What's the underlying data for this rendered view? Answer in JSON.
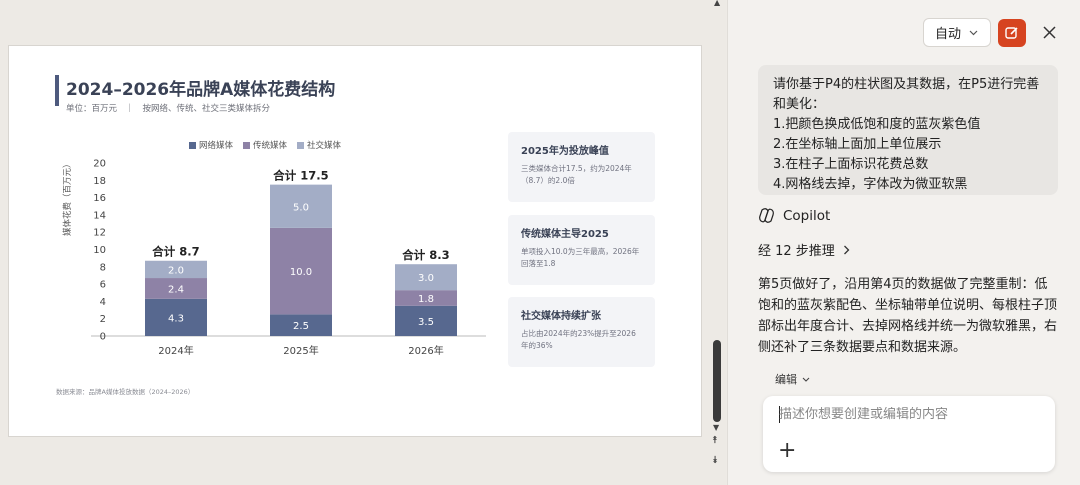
{
  "slide": {
    "title": "2024–2026年品牌A媒体花费结构",
    "subtitle": "单位：百万元　｜　按网络、传统、社交三类媒体拆分",
    "legend": [
      {
        "label": "网络媒体",
        "color": "#57688f"
      },
      {
        "label": "传统媒体",
        "color": "#8e82a6"
      },
      {
        "label": "社交媒体",
        "color": "#a3adc6"
      }
    ],
    "y_title": "媒体花费（百万元）",
    "source": "数据来源：品牌A媒体投放数据（2024–2026）",
    "cards": [
      {
        "title": "2025年为投放峰值",
        "body": "三类媒体合计17.5，约为2024年（8.7）的2.0倍"
      },
      {
        "title": "传统媒体主导2025",
        "body": "单项投入10.0为三年最高，2026年回落至1.8"
      },
      {
        "title": "社交媒体持续扩张",
        "body": "占比由2024年的23%提升至2026年的36%"
      }
    ]
  },
  "chart_data": {
    "type": "bar",
    "stacked": true,
    "categories": [
      "2024年",
      "2025年",
      "2026年"
    ],
    "series": [
      {
        "name": "网络媒体",
        "values": [
          4.3,
          2.5,
          3.5
        ],
        "color": "#57688f"
      },
      {
        "name": "传统媒体",
        "values": [
          2.4,
          10.0,
          1.8
        ],
        "color": "#8e82a6"
      },
      {
        "name": "社交媒体",
        "values": [
          2.0,
          5.0,
          3.0
        ],
        "color": "#a3adc6"
      }
    ],
    "value_labels": [
      [
        "4.3",
        "2.4",
        "2.0"
      ],
      [
        "2.5",
        "10.0",
        "5.0"
      ],
      [
        "3.5",
        "1.8",
        "3.0"
      ]
    ],
    "totals": [
      "合计 8.7",
      "合计 17.5",
      "合计 8.3"
    ],
    "y_ticks": [
      "0",
      "2",
      "4",
      "6",
      "8",
      "10",
      "12",
      "14",
      "16",
      "18",
      "20"
    ],
    "ylim": [
      0,
      20
    ],
    "ylabel": "媒体花费（百万元）",
    "grid": false,
    "legend_position": "top"
  },
  "scrollbar": {
    "up": "▲",
    "down": "▼",
    "prev": "⯭",
    "next": "⯯"
  },
  "pane": {
    "mode": "自动",
    "user_message": [
      "请你基于P4的柱状图及其数据，在P5进行完善和美化：",
      "1.把颜色换成低饱和度的蓝灰紫色值",
      "2.在坐标轴上面加上单位展示",
      "3.在柱子上面标识花费总数",
      "4.网格线去掉，字体改为微亚软黑"
    ],
    "assistant_name": "Copilot",
    "reasoning": "经 12 步推理",
    "reply": "第5页做好了，沿用第4页的数据做了完整重制：低饱和的蓝灰紫配色、坐标轴带单位说明、每根柱子顶部标出年度合计、去掉网格线并统一为微软雅黑，右侧还补了三条数据要点和数据来源。",
    "edit_mode": "编辑",
    "compose_placeholder": "描述你想要创建或编辑的内容",
    "add_label": "+"
  }
}
